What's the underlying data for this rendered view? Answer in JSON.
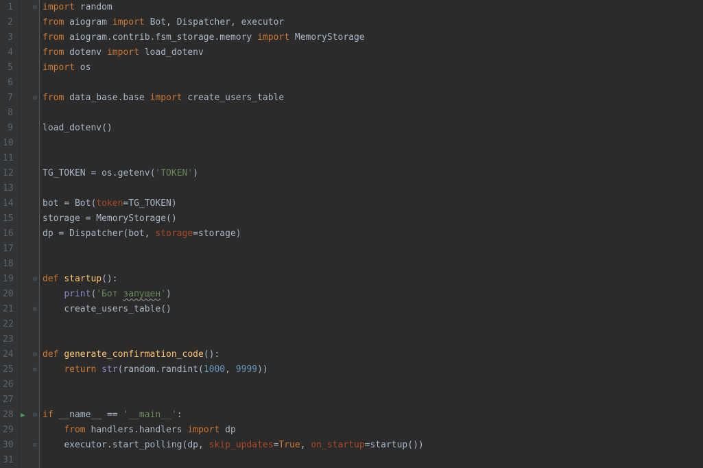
{
  "lines": [
    {
      "n": 1,
      "fold": "⊟",
      "tokens": [
        [
          "kw",
          "import"
        ],
        [
          "",
          " "
        ],
        [
          "ident",
          "random"
        ]
      ]
    },
    {
      "n": 2,
      "fold": "",
      "tokens": [
        [
          "kw",
          "from"
        ],
        [
          "",
          " "
        ],
        [
          "ident",
          "aiogram"
        ],
        [
          "",
          " "
        ],
        [
          "kw",
          "import"
        ],
        [
          "",
          " "
        ],
        [
          "ident",
          "Bot"
        ],
        [
          "punct",
          ","
        ],
        [
          "",
          " "
        ],
        [
          "ident",
          "Dispatcher"
        ],
        [
          "punct",
          ","
        ],
        [
          "",
          " "
        ],
        [
          "ident",
          "executor"
        ]
      ]
    },
    {
      "n": 3,
      "fold": "",
      "tokens": [
        [
          "kw",
          "from"
        ],
        [
          "",
          " "
        ],
        [
          "ident",
          "aiogram.contrib.fsm_storage.memory"
        ],
        [
          "",
          " "
        ],
        [
          "kw",
          "import"
        ],
        [
          "",
          " "
        ],
        [
          "ident",
          "MemoryStorage"
        ]
      ]
    },
    {
      "n": 4,
      "fold": "",
      "tokens": [
        [
          "kw",
          "from"
        ],
        [
          "",
          " "
        ],
        [
          "ident",
          "dotenv"
        ],
        [
          "",
          " "
        ],
        [
          "kw",
          "import"
        ],
        [
          "",
          " "
        ],
        [
          "ident",
          "load_dotenv"
        ]
      ]
    },
    {
      "n": 5,
      "fold": "",
      "tokens": [
        [
          "kw",
          "import"
        ],
        [
          "",
          " "
        ],
        [
          "ident",
          "os"
        ]
      ]
    },
    {
      "n": 6,
      "fold": "",
      "tokens": [
        [
          "",
          ""
        ]
      ]
    },
    {
      "n": 7,
      "fold": "⊟",
      "tokens": [
        [
          "kw",
          "from"
        ],
        [
          "",
          " "
        ],
        [
          "ident",
          "data_base.base"
        ],
        [
          "",
          " "
        ],
        [
          "kw",
          "import"
        ],
        [
          "",
          " "
        ],
        [
          "ident",
          "create_users_table"
        ]
      ]
    },
    {
      "n": 8,
      "fold": "",
      "tokens": [
        [
          "",
          ""
        ]
      ]
    },
    {
      "n": 9,
      "fold": "",
      "tokens": [
        [
          "ident",
          "load_dotenv"
        ],
        [
          "punct",
          "()"
        ]
      ]
    },
    {
      "n": 10,
      "fold": "",
      "tokens": [
        [
          "",
          ""
        ]
      ]
    },
    {
      "n": 11,
      "fold": "",
      "tokens": [
        [
          "",
          ""
        ]
      ]
    },
    {
      "n": 12,
      "fold": "",
      "tokens": [
        [
          "ident",
          "TG_TOKEN "
        ],
        [
          "punct",
          "="
        ],
        [
          "ident",
          " os.getenv"
        ],
        [
          "punct",
          "("
        ],
        [
          "str",
          "'TOKEN'"
        ],
        [
          "punct",
          ")"
        ]
      ]
    },
    {
      "n": 13,
      "fold": "",
      "tokens": [
        [
          "",
          ""
        ]
      ]
    },
    {
      "n": 14,
      "fold": "",
      "tokens": [
        [
          "ident",
          "bot "
        ],
        [
          "punct",
          "="
        ],
        [
          "ident",
          " Bot"
        ],
        [
          "punct",
          "("
        ],
        [
          "param",
          "token"
        ],
        [
          "punct",
          "="
        ],
        [
          "ident",
          "TG_TOKEN"
        ],
        [
          "punct",
          ")"
        ]
      ]
    },
    {
      "n": 15,
      "fold": "",
      "tokens": [
        [
          "ident",
          "storage "
        ],
        [
          "punct",
          "="
        ],
        [
          "ident",
          " MemoryStorage"
        ],
        [
          "punct",
          "()"
        ]
      ]
    },
    {
      "n": 16,
      "fold": "",
      "tokens": [
        [
          "ident",
          "dp "
        ],
        [
          "punct",
          "="
        ],
        [
          "ident",
          " Dispatcher"
        ],
        [
          "punct",
          "("
        ],
        [
          "ident",
          "bot"
        ],
        [
          "punct",
          ","
        ],
        [
          "",
          " "
        ],
        [
          "param",
          "storage"
        ],
        [
          "punct",
          "="
        ],
        [
          "ident",
          "storage"
        ],
        [
          "punct",
          ")"
        ]
      ]
    },
    {
      "n": 17,
      "fold": "",
      "tokens": [
        [
          "",
          ""
        ]
      ]
    },
    {
      "n": 18,
      "fold": "",
      "tokens": [
        [
          "",
          ""
        ]
      ]
    },
    {
      "n": 19,
      "fold": "⊟",
      "tokens": [
        [
          "kw",
          "def"
        ],
        [
          "",
          " "
        ],
        [
          "funcdef",
          "startup"
        ],
        [
          "punct",
          "():"
        ]
      ]
    },
    {
      "n": 20,
      "fold": "",
      "tokens": [
        [
          "",
          "    "
        ],
        [
          "builtin",
          "print"
        ],
        [
          "punct",
          "("
        ],
        [
          "str",
          "'Бот "
        ],
        [
          "str underline-wavy",
          "запущен"
        ],
        [
          "str",
          "'"
        ],
        [
          "punct",
          ")"
        ]
      ]
    },
    {
      "n": 21,
      "fold": "⊡",
      "tokens": [
        [
          "",
          "    "
        ],
        [
          "ident",
          "create_users_table"
        ],
        [
          "punct",
          "()"
        ]
      ]
    },
    {
      "n": 22,
      "fold": "",
      "tokens": [
        [
          "",
          ""
        ]
      ]
    },
    {
      "n": 23,
      "fold": "",
      "tokens": [
        [
          "",
          ""
        ]
      ]
    },
    {
      "n": 24,
      "fold": "⊟",
      "tokens": [
        [
          "kw",
          "def"
        ],
        [
          "",
          " "
        ],
        [
          "funcdef",
          "generate_confirmation_code"
        ],
        [
          "punct",
          "():"
        ]
      ]
    },
    {
      "n": 25,
      "fold": "⊡",
      "tokens": [
        [
          "",
          "    "
        ],
        [
          "kw",
          "return"
        ],
        [
          "",
          " "
        ],
        [
          "builtin",
          "str"
        ],
        [
          "punct",
          "("
        ],
        [
          "ident",
          "random.randint"
        ],
        [
          "punct",
          "("
        ],
        [
          "num",
          "1000"
        ],
        [
          "punct",
          ","
        ],
        [
          "",
          " "
        ],
        [
          "num",
          "9999"
        ],
        [
          "punct",
          "))"
        ]
      ]
    },
    {
      "n": 26,
      "fold": "",
      "tokens": [
        [
          "",
          ""
        ]
      ]
    },
    {
      "n": 27,
      "fold": "",
      "tokens": [
        [
          "",
          ""
        ]
      ]
    },
    {
      "n": 28,
      "fold": "⊟",
      "run": true,
      "tokens": [
        [
          "kw",
          "if"
        ],
        [
          "",
          " "
        ],
        [
          "ident",
          "__name__ "
        ],
        [
          "punct",
          "=="
        ],
        [
          "",
          " "
        ],
        [
          "str",
          "'__main__'"
        ],
        [
          "punct",
          ":"
        ]
      ]
    },
    {
      "n": 29,
      "fold": "",
      "tokens": [
        [
          "",
          "    "
        ],
        [
          "kw",
          "from"
        ],
        [
          "",
          " "
        ],
        [
          "ident",
          "handlers.handlers"
        ],
        [
          "",
          " "
        ],
        [
          "kw",
          "import"
        ],
        [
          "",
          " "
        ],
        [
          "ident",
          "dp"
        ]
      ]
    },
    {
      "n": 30,
      "fold": "⊡",
      "tokens": [
        [
          "",
          "    "
        ],
        [
          "ident",
          "executor.start_polling"
        ],
        [
          "punct",
          "("
        ],
        [
          "ident",
          "dp"
        ],
        [
          "punct",
          ","
        ],
        [
          "",
          " "
        ],
        [
          "param",
          "skip_updates"
        ],
        [
          "punct",
          "="
        ],
        [
          "kw",
          "True"
        ],
        [
          "punct",
          ","
        ],
        [
          "",
          " "
        ],
        [
          "param",
          "on_startup"
        ],
        [
          "punct",
          "="
        ],
        [
          "ident",
          "startup"
        ],
        [
          "punct",
          "())"
        ]
      ]
    },
    {
      "n": 31,
      "fold": "",
      "tokens": [
        [
          "",
          ""
        ]
      ]
    }
  ]
}
